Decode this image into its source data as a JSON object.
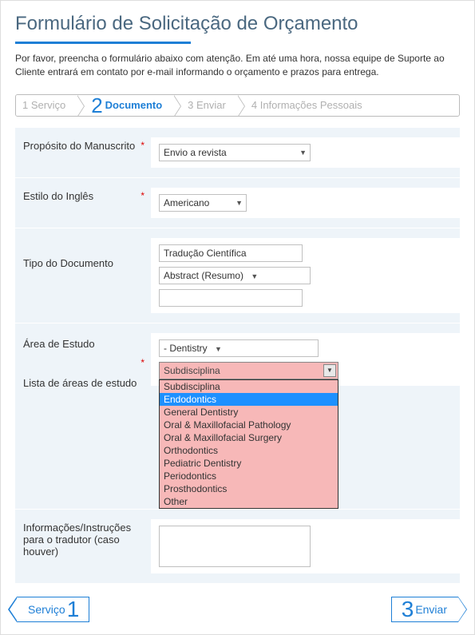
{
  "title": "Formulário de Solicitação de Orçamento",
  "intro": "Por favor, preencha o formulário abaixo com atenção. Em até uma hora, nossa equipe de Suporte ao Cliente entrará em contato por e-mail informando o orçamento e prazos para entrega.",
  "steps": {
    "s1": "1 Serviço",
    "s2_num": "2",
    "s2_label": "Documento",
    "s3": "3 Enviar",
    "s4": "4 Informações Pessoais"
  },
  "labels": {
    "purpose": "Propósito do Manuscrito",
    "english_style": "Estilo do Inglês",
    "doc_type": "Tipo do Documento",
    "study_area": "Área de Estudo",
    "study_list": "Lista de áreas de estudo",
    "instructions": "Informações/Instruções para o tradutor (caso houver)"
  },
  "fields": {
    "purpose_value": "Envio a revista",
    "english_value": "Americano",
    "doc_type_text": "Tradução Científica",
    "doc_type_select": "Abstract (Resumo)",
    "doc_type_extra": "",
    "study_area_value": "- Dentistry",
    "subdiscipline_selected": "Subdisciplina",
    "subdiscipline_options": [
      "Subdisciplina",
      "Endodontics",
      "General Dentistry",
      "Oral & Maxillofacial Pathology",
      "Oral & Maxillofacial Surgery",
      "Orthodontics",
      "Pediatric Dentistry",
      "Periodontics",
      "Prosthodontics",
      "Other"
    ],
    "highlighted_option_index": 1
  },
  "nav": {
    "prev_label": "Serviço",
    "prev_num": "1",
    "next_num": "3",
    "next_label": "Enviar"
  }
}
